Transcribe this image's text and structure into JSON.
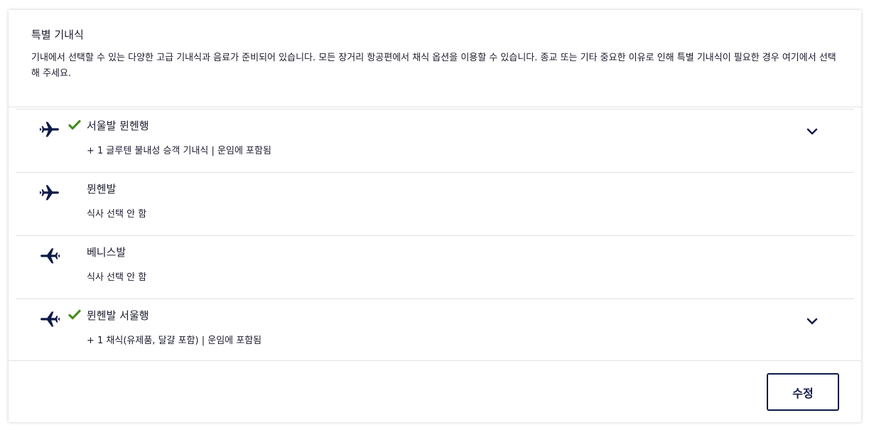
{
  "section": {
    "title": "특별 기내식",
    "description": "기내에서 선택할 수 있는 다양한 고급 기내식과 음료가 준비되어 있습니다. 모든 장거리 항공편에서 채식 옵션을 이용할 수 있습니다. 종교 또는 기타 중요한 이유로 인해 특별 기내식이 필요한 경우 여기에서 선택해 주세요."
  },
  "segments": [
    {
      "title": "서울발 뮌헨행",
      "meal": "+ 1 글루텐 불내성 승객 기내식 | 운임에 포함됨",
      "direction": "outbound",
      "icon": "plane-departure-icon",
      "selected": true,
      "expandable": true
    },
    {
      "title": "뮌헨발",
      "meal": "식사 선택 안 함",
      "direction": "outbound",
      "icon": "plane-departure-icon",
      "selected": false,
      "expandable": false
    },
    {
      "title": "베니스발",
      "meal": "식사 선택 안 함",
      "direction": "inbound",
      "icon": "plane-return-icon",
      "selected": false,
      "expandable": false
    },
    {
      "title": "뮌헨발 서울행",
      "meal": "+ 1 채식(유제품, 달걀 포함) | 운임에 포함됨",
      "direction": "inbound",
      "icon": "plane-return-icon",
      "selected": true,
      "expandable": true
    }
  ],
  "footer": {
    "edit_label": "수정"
  },
  "colors": {
    "brand_navy": "#0e1a48",
    "check_green": "#4b8b1f",
    "divider": "#e2e2e2"
  }
}
